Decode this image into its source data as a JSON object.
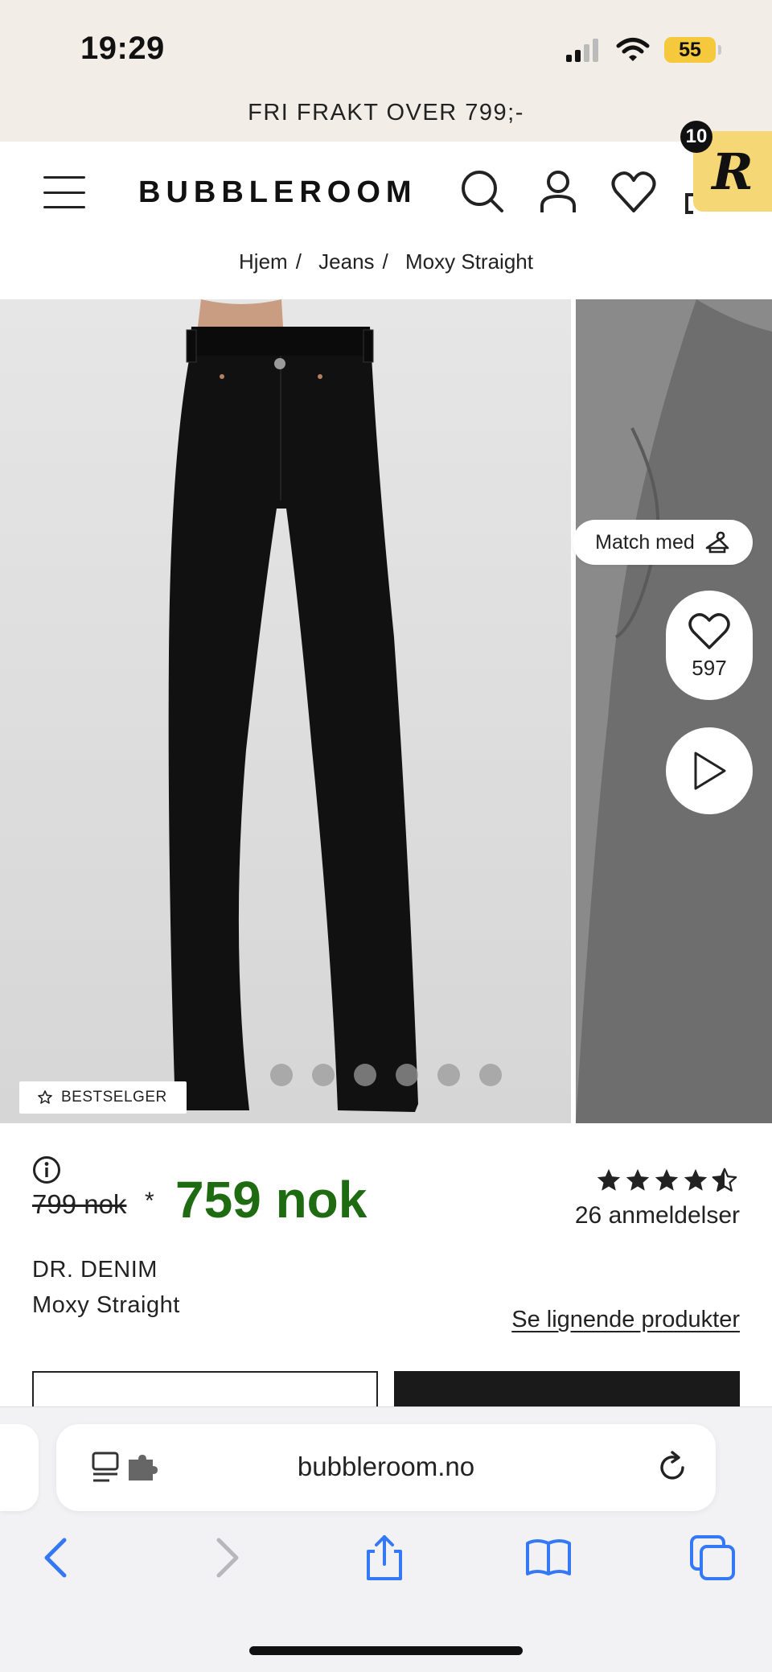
{
  "status_bar": {
    "time": "19:29",
    "battery": "55"
  },
  "promo": {
    "text": "FRI FRAKT OVER 799;-"
  },
  "header": {
    "logo": "BUBBLEROOM",
    "badge_letter": "R",
    "badge_count": "10"
  },
  "breadcrumb": {
    "items": [
      "Hjem",
      "Jeans",
      "Moxy Straight"
    ],
    "separator": "/"
  },
  "gallery": {
    "bestseller_label": "BESTSELGER",
    "match_label": "Match med",
    "favorites_count": "597",
    "dot_count": 6,
    "active_dot": 0
  },
  "product": {
    "old_price": "799 nok",
    "asterisk": "*",
    "price": "759 nok",
    "rating": 4.5,
    "reviews": "26 anmeldelser",
    "brand": "DR. DENIM",
    "name": "Moxy Straight",
    "similar_link": "Se lignende produkter"
  },
  "browser": {
    "url": "bubbleroom.no"
  },
  "colors": {
    "price_green": "#1e6b12",
    "accent_yellow": "#f6d776",
    "promo_bg": "#f3ede8",
    "ios_blue": "#3478f6"
  },
  "icons": {
    "header": [
      "menu-icon",
      "search-icon",
      "account-icon",
      "heart-icon",
      "cart-icon"
    ],
    "browser": [
      "reader-icon",
      "extension-icon",
      "reload-icon",
      "back-icon",
      "forward-icon",
      "share-icon",
      "bookmarks-icon",
      "tabs-icon"
    ]
  }
}
